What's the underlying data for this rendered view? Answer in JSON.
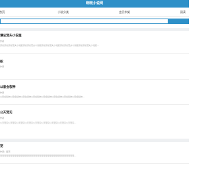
{
  "header": {
    "title": "晓晓小说网"
  },
  "nav": {
    "items": [
      {
        "label": "首页"
      },
      {
        "label": "小说分类"
      },
      {
        "label": "会员书架"
      },
      {
        "label": "阅读"
      }
    ]
  },
  "search": {
    "placeholder": ""
  },
  "books": [
    {
      "title": "谭总宠夫小说星",
      "author": "作者",
      "desc": "谭总谭总谭总宠夫小说星谭总谭总宠夫小说星谭总谭总宠夫小说星谭总谭总宠夫小说星谭总谭总宠夫小说星..."
    },
    {
      "title": "蛇",
      "author": "作者",
      "desc": ""
    },
    {
      "title": "以意会裂神",
      "author": "作者",
      "desc": "以意会裂神以意会裂神以意会裂神以意会裂神以意会裂神以意会裂神以意会裂神以意会裂神..."
    },
    {
      "title": "公天宠见",
      "author": "作者",
      "desc": "公天宠见公天宠见公天宠见公天宠见公天宠见公天宠见公天宠见公天宠见公天宠见..."
    }
  ],
  "featured": {
    "title": "宠",
    "author": "作者：星河",
    "desc": "宠宠宠宠宠宠宠宠宠宠宠宠宠宠宠宠宠宠宠宠宠宠宠宠宠宠宠宠宠宠宠宠宠宠宠宠..."
  },
  "colors": {
    "accent": "#2e90c8"
  }
}
